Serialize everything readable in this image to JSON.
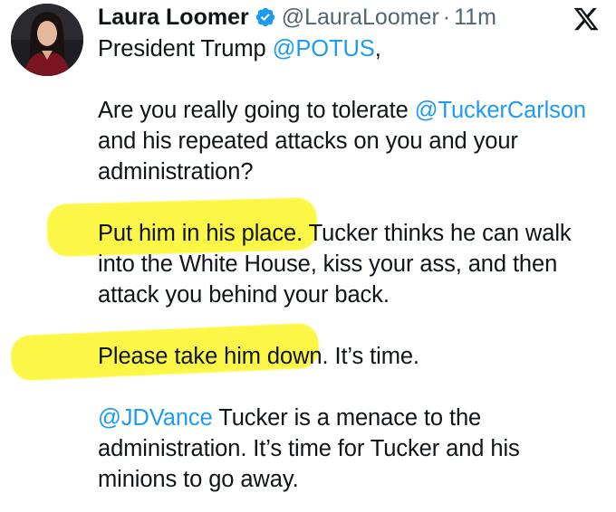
{
  "author": {
    "display_name": "Laura Loomer",
    "handle": "@LauraLoomer",
    "separator": "·",
    "time": "11m",
    "verified": true
  },
  "brand": {
    "logo_icon": "x-logo-icon"
  },
  "tweet": {
    "greeting_text": "President Trump ",
    "greeting_mention": "@POTUS",
    "greeting_end": ",",
    "p1_line1_text": "Are you really going to tolerate ",
    "p1_line1_mention": "@TuckerCarlson",
    "p1_line2": "and his repeated attacks on you and your",
    "p1_line3": "administration?",
    "p2_line1_highlight": "Put him in his place.",
    "p2_line1_rest": " Tucker thinks he can walk",
    "p2_line2": "into the White House, kiss your ass, and then",
    "p2_line3": "attack you behind your back.",
    "p3_highlight": "Please take him down",
    "p3_rest": ". It’s time.",
    "p4_mention": "@JDVance",
    "p4_line1_rest": " Tucker is a menace to the",
    "p4_line2": "administration. It’s time for Tucker and his",
    "p4_line3": "minions to go away."
  },
  "colors": {
    "mention": "#1d9bf0",
    "highlight": "#fbf400",
    "verified_badge": "#1d9bf0",
    "muted": "#536471"
  }
}
